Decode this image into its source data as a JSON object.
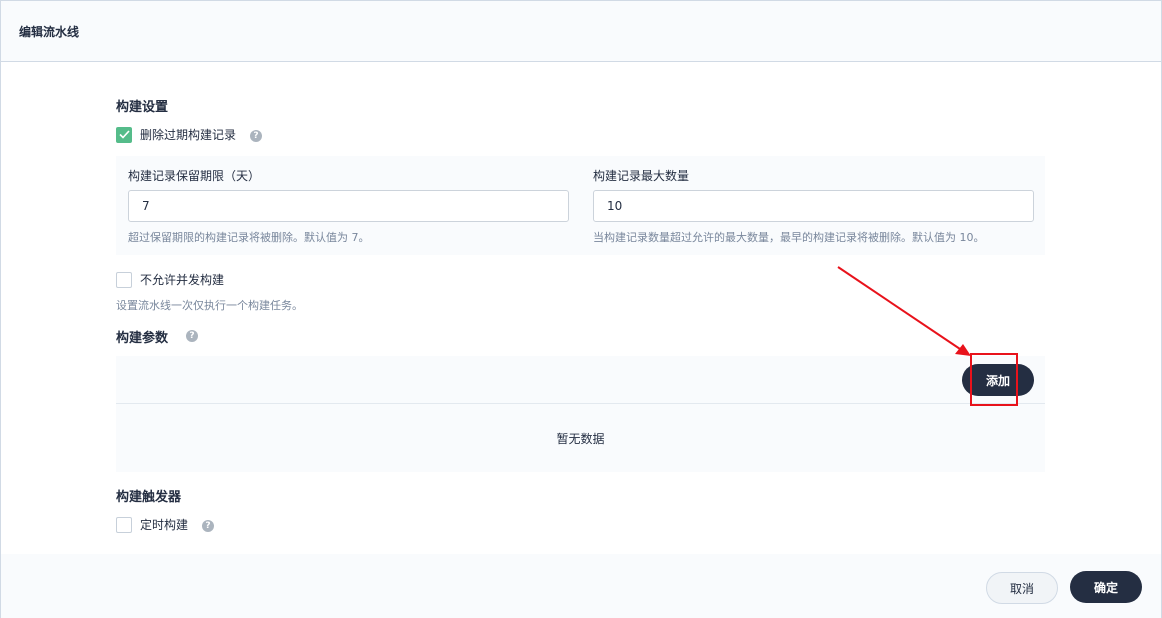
{
  "dialog": {
    "title": "编辑流水线"
  },
  "build_settings": {
    "title": "构建设置",
    "discard_old": {
      "label": "删除过期构建记录",
      "checked": true,
      "help_icon": "question-icon"
    },
    "retention_days": {
      "label": "构建记录保留期限（天）",
      "value": "7",
      "description": "超过保留期限的构建记录将被删除。默认值为 7。"
    },
    "max_records": {
      "label": "构建记录最大数量",
      "value": "10",
      "description": "当构建记录数量超过允许的最大数量，最早的构建记录将被删除。默认值为 10。"
    },
    "no_concurrent": {
      "label": "不允许并发构建",
      "checked": false,
      "description": "设置流水线一次仅执行一个构建任务。"
    }
  },
  "build_params": {
    "title": "构建参数",
    "help_icon": "question-icon",
    "add_label": "添加",
    "empty_text": "暂无数据"
  },
  "build_triggers": {
    "title": "构建触发器",
    "scheduled": {
      "label": "定时构建",
      "checked": false,
      "help_icon": "question-icon"
    }
  },
  "footer": {
    "cancel_label": "取消",
    "confirm_label": "确定"
  },
  "colors": {
    "primary_dark": "#242e42",
    "checkbox_green": "#55bc8a",
    "annotation_red": "#e8121b"
  }
}
